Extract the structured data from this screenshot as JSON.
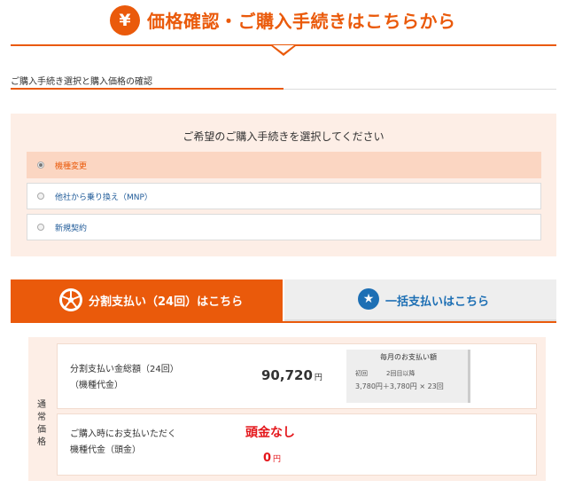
{
  "header": {
    "icon_symbol": "¥",
    "title": "価格確認・ご購入手続きはこちらから"
  },
  "section": {
    "subtitle": "ご購入手続き選択と購入価格の確認"
  },
  "procedure": {
    "heading": "ご希望のご購入手続きを選択してください",
    "options": [
      {
        "label": "機種変更",
        "selected": true
      },
      {
        "label": "他社から乗り換え（MNP）",
        "selected": false
      },
      {
        "label": "新規契約",
        "selected": false
      }
    ]
  },
  "payment_tabs": {
    "split": {
      "label": "分割支払い（24回）はこちら",
      "active": true
    },
    "lump": {
      "label": "一括支払いはこちら",
      "active": false
    }
  },
  "price": {
    "side_label": "通常価格",
    "total": {
      "label_line1": "分割支払い金総額（24回）",
      "label_line2": "（機種代金）",
      "value": "90,720",
      "unit": "円"
    },
    "monthly": {
      "title": "毎月のお支払い額",
      "first_label": "初回",
      "later_label": "2回目以降",
      "formula": "3,780円＋3,780円 × 23回"
    },
    "down_payment": {
      "label_line1": "ご購入時にお支払いただく",
      "label_line2": "機種代金（頭金）",
      "none_text": "頭金なし",
      "value": "0",
      "unit": "円"
    }
  },
  "colors": {
    "accent": "#ea5a0b",
    "panel_bg": "#fdeee6",
    "link_blue": "#1d6fb4",
    "price_red": "#e4161b"
  }
}
